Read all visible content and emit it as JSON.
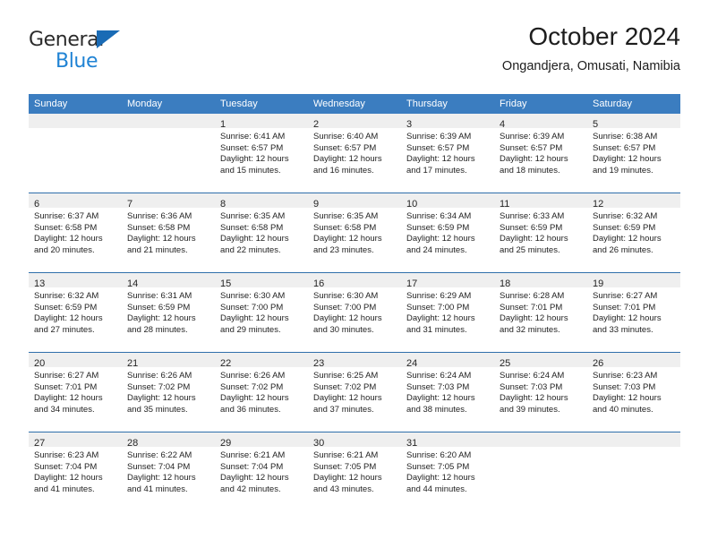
{
  "brand": {
    "name_part1": "General",
    "name_part2": "Blue",
    "logo_icon": "triangle-logo-icon",
    "color_dark": "#2b2b2b",
    "color_blue": "#2083d4"
  },
  "header": {
    "title": "October 2024",
    "subtitle": "Ongandjera, Omusati, Namibia"
  },
  "colors": {
    "header_blue": "#3b7dc0",
    "row_separator": "#2f6fab",
    "daynum_band": "#efefef",
    "text": "#1f1f1f"
  },
  "weekday_headers": [
    "Sunday",
    "Monday",
    "Tuesday",
    "Wednesday",
    "Thursday",
    "Friday",
    "Saturday"
  ],
  "weeks": [
    [
      {
        "day": "",
        "sunrise": "",
        "sunset": "",
        "daylight_line1": "",
        "daylight_line2": ""
      },
      {
        "day": "",
        "sunrise": "",
        "sunset": "",
        "daylight_line1": "",
        "daylight_line2": ""
      },
      {
        "day": "1",
        "sunrise": "Sunrise: 6:41 AM",
        "sunset": "Sunset: 6:57 PM",
        "daylight_line1": "Daylight: 12 hours",
        "daylight_line2": "and 15 minutes."
      },
      {
        "day": "2",
        "sunrise": "Sunrise: 6:40 AM",
        "sunset": "Sunset: 6:57 PM",
        "daylight_line1": "Daylight: 12 hours",
        "daylight_line2": "and 16 minutes."
      },
      {
        "day": "3",
        "sunrise": "Sunrise: 6:39 AM",
        "sunset": "Sunset: 6:57 PM",
        "daylight_line1": "Daylight: 12 hours",
        "daylight_line2": "and 17 minutes."
      },
      {
        "day": "4",
        "sunrise": "Sunrise: 6:39 AM",
        "sunset": "Sunset: 6:57 PM",
        "daylight_line1": "Daylight: 12 hours",
        "daylight_line2": "and 18 minutes."
      },
      {
        "day": "5",
        "sunrise": "Sunrise: 6:38 AM",
        "sunset": "Sunset: 6:57 PM",
        "daylight_line1": "Daylight: 12 hours",
        "daylight_line2": "and 19 minutes."
      }
    ],
    [
      {
        "day": "6",
        "sunrise": "Sunrise: 6:37 AM",
        "sunset": "Sunset: 6:58 PM",
        "daylight_line1": "Daylight: 12 hours",
        "daylight_line2": "and 20 minutes."
      },
      {
        "day": "7",
        "sunrise": "Sunrise: 6:36 AM",
        "sunset": "Sunset: 6:58 PM",
        "daylight_line1": "Daylight: 12 hours",
        "daylight_line2": "and 21 minutes."
      },
      {
        "day": "8",
        "sunrise": "Sunrise: 6:35 AM",
        "sunset": "Sunset: 6:58 PM",
        "daylight_line1": "Daylight: 12 hours",
        "daylight_line2": "and 22 minutes."
      },
      {
        "day": "9",
        "sunrise": "Sunrise: 6:35 AM",
        "sunset": "Sunset: 6:58 PM",
        "daylight_line1": "Daylight: 12 hours",
        "daylight_line2": "and 23 minutes."
      },
      {
        "day": "10",
        "sunrise": "Sunrise: 6:34 AM",
        "sunset": "Sunset: 6:59 PM",
        "daylight_line1": "Daylight: 12 hours",
        "daylight_line2": "and 24 minutes."
      },
      {
        "day": "11",
        "sunrise": "Sunrise: 6:33 AM",
        "sunset": "Sunset: 6:59 PM",
        "daylight_line1": "Daylight: 12 hours",
        "daylight_line2": "and 25 minutes."
      },
      {
        "day": "12",
        "sunrise": "Sunrise: 6:32 AM",
        "sunset": "Sunset: 6:59 PM",
        "daylight_line1": "Daylight: 12 hours",
        "daylight_line2": "and 26 minutes."
      }
    ],
    [
      {
        "day": "13",
        "sunrise": "Sunrise: 6:32 AM",
        "sunset": "Sunset: 6:59 PM",
        "daylight_line1": "Daylight: 12 hours",
        "daylight_line2": "and 27 minutes."
      },
      {
        "day": "14",
        "sunrise": "Sunrise: 6:31 AM",
        "sunset": "Sunset: 6:59 PM",
        "daylight_line1": "Daylight: 12 hours",
        "daylight_line2": "and 28 minutes."
      },
      {
        "day": "15",
        "sunrise": "Sunrise: 6:30 AM",
        "sunset": "Sunset: 7:00 PM",
        "daylight_line1": "Daylight: 12 hours",
        "daylight_line2": "and 29 minutes."
      },
      {
        "day": "16",
        "sunrise": "Sunrise: 6:30 AM",
        "sunset": "Sunset: 7:00 PM",
        "daylight_line1": "Daylight: 12 hours",
        "daylight_line2": "and 30 minutes."
      },
      {
        "day": "17",
        "sunrise": "Sunrise: 6:29 AM",
        "sunset": "Sunset: 7:00 PM",
        "daylight_line1": "Daylight: 12 hours",
        "daylight_line2": "and 31 minutes."
      },
      {
        "day": "18",
        "sunrise": "Sunrise: 6:28 AM",
        "sunset": "Sunset: 7:01 PM",
        "daylight_line1": "Daylight: 12 hours",
        "daylight_line2": "and 32 minutes."
      },
      {
        "day": "19",
        "sunrise": "Sunrise: 6:27 AM",
        "sunset": "Sunset: 7:01 PM",
        "daylight_line1": "Daylight: 12 hours",
        "daylight_line2": "and 33 minutes."
      }
    ],
    [
      {
        "day": "20",
        "sunrise": "Sunrise: 6:27 AM",
        "sunset": "Sunset: 7:01 PM",
        "daylight_line1": "Daylight: 12 hours",
        "daylight_line2": "and 34 minutes."
      },
      {
        "day": "21",
        "sunrise": "Sunrise: 6:26 AM",
        "sunset": "Sunset: 7:02 PM",
        "daylight_line1": "Daylight: 12 hours",
        "daylight_line2": "and 35 minutes."
      },
      {
        "day": "22",
        "sunrise": "Sunrise: 6:26 AM",
        "sunset": "Sunset: 7:02 PM",
        "daylight_line1": "Daylight: 12 hours",
        "daylight_line2": "and 36 minutes."
      },
      {
        "day": "23",
        "sunrise": "Sunrise: 6:25 AM",
        "sunset": "Sunset: 7:02 PM",
        "daylight_line1": "Daylight: 12 hours",
        "daylight_line2": "and 37 minutes."
      },
      {
        "day": "24",
        "sunrise": "Sunrise: 6:24 AM",
        "sunset": "Sunset: 7:03 PM",
        "daylight_line1": "Daylight: 12 hours",
        "daylight_line2": "and 38 minutes."
      },
      {
        "day": "25",
        "sunrise": "Sunrise: 6:24 AM",
        "sunset": "Sunset: 7:03 PM",
        "daylight_line1": "Daylight: 12 hours",
        "daylight_line2": "and 39 minutes."
      },
      {
        "day": "26",
        "sunrise": "Sunrise: 6:23 AM",
        "sunset": "Sunset: 7:03 PM",
        "daylight_line1": "Daylight: 12 hours",
        "daylight_line2": "and 40 minutes."
      }
    ],
    [
      {
        "day": "27",
        "sunrise": "Sunrise: 6:23 AM",
        "sunset": "Sunset: 7:04 PM",
        "daylight_line1": "Daylight: 12 hours",
        "daylight_line2": "and 41 minutes."
      },
      {
        "day": "28",
        "sunrise": "Sunrise: 6:22 AM",
        "sunset": "Sunset: 7:04 PM",
        "daylight_line1": "Daylight: 12 hours",
        "daylight_line2": "and 41 minutes."
      },
      {
        "day": "29",
        "sunrise": "Sunrise: 6:21 AM",
        "sunset": "Sunset: 7:04 PM",
        "daylight_line1": "Daylight: 12 hours",
        "daylight_line2": "and 42 minutes."
      },
      {
        "day": "30",
        "sunrise": "Sunrise: 6:21 AM",
        "sunset": "Sunset: 7:05 PM",
        "daylight_line1": "Daylight: 12 hours",
        "daylight_line2": "and 43 minutes."
      },
      {
        "day": "31",
        "sunrise": "Sunrise: 6:20 AM",
        "sunset": "Sunset: 7:05 PM",
        "daylight_line1": "Daylight: 12 hours",
        "daylight_line2": "and 44 minutes."
      },
      {
        "day": "",
        "sunrise": "",
        "sunset": "",
        "daylight_line1": "",
        "daylight_line2": ""
      },
      {
        "day": "",
        "sunrise": "",
        "sunset": "",
        "daylight_line1": "",
        "daylight_line2": ""
      }
    ]
  ]
}
